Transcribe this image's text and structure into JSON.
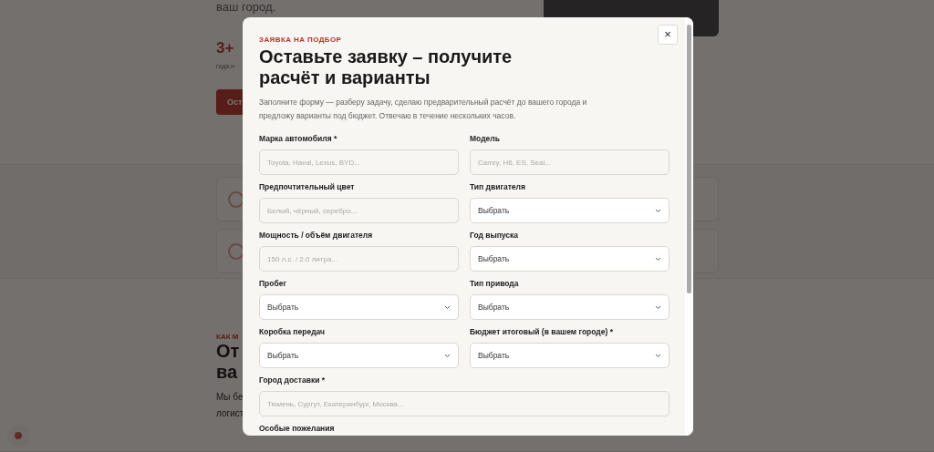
{
  "background_page": {
    "hero_text": "ваш город.",
    "stat_value": "3+",
    "stat_caption": "года н",
    "cta_button": "Ост",
    "section_eyebrow": "КАК М",
    "section_title_lines": [
      "От",
      "ва"
    ],
    "section_text_lines": [
      "Мы бе",
      "логист"
    ]
  },
  "modal": {
    "eyebrow": "ЗАЯВКА НА ПОДБОР",
    "title": "Оставьте заявку – получите расчёт и варианты",
    "description": "Заполните форму — разберу задачу, сделаю предварительный расчёт до вашего города и предложу варианты под бюджет. Отвечаю в течение нескольких часов.",
    "close": "×",
    "fields": [
      {
        "kind": "text",
        "label": "Марка автомобиля *",
        "placeholder": "Toyota, Haval, Lexus, BYD..."
      },
      {
        "kind": "text",
        "label": "Модель",
        "placeholder": "Camry, H6, ES, Seal..."
      },
      {
        "kind": "text",
        "label": "Предпочтительный цвет",
        "placeholder": "Белый, чёрный, серебро..."
      },
      {
        "kind": "select",
        "label": "Тип двигателя",
        "value": "Выбрать"
      },
      {
        "kind": "text",
        "label": "Мощность / объём двигателя",
        "placeholder": "150 л.с. / 2.0 литра..."
      },
      {
        "kind": "select",
        "label": "Год выпуска",
        "value": "Выбрать"
      },
      {
        "kind": "select",
        "label": "Пробег",
        "value": "Выбрать"
      },
      {
        "kind": "select",
        "label": "Тип привода",
        "value": "Выбрать"
      },
      {
        "kind": "select",
        "label": "Коробка передач",
        "value": "Выбрать"
      },
      {
        "kind": "select",
        "label": "Бюджет итоговый (в вашем городе) *",
        "value": "Выбрать"
      }
    ],
    "full_width_fields": [
      {
        "kind": "text",
        "label": "Город доставки *",
        "placeholder": "Тюмень, Сургут, Екатеринбург, Москва..."
      },
      {
        "kind": "label",
        "label": "Особые пожелания"
      }
    ]
  }
}
